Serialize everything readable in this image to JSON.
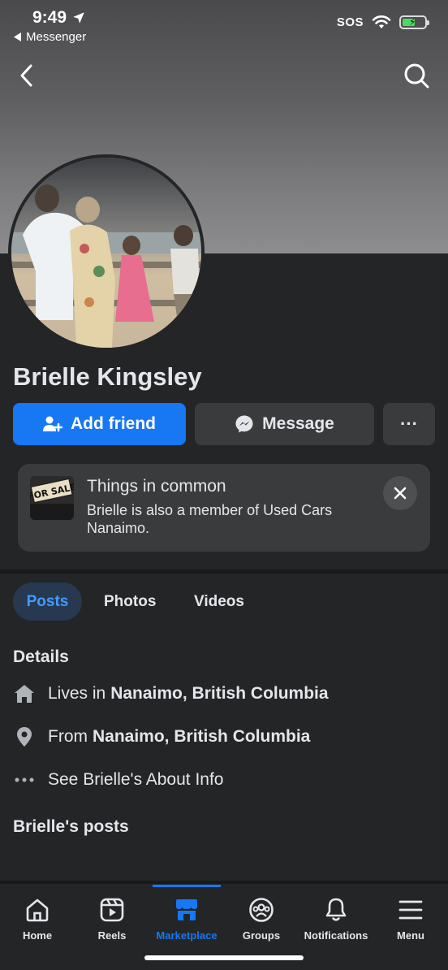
{
  "status_bar": {
    "time": "9:49",
    "back_app": "Messenger",
    "sos": "SOS"
  },
  "profile": {
    "name": "Brielle Kingsley"
  },
  "actions": {
    "add_friend": "Add friend",
    "message": "Message",
    "more": "···"
  },
  "things_in_common": {
    "title": "Things in common",
    "text": "Brielle is also a member of Used Cars Nanaimo.",
    "thumb_text": "FOR SALE"
  },
  "tabs": [
    {
      "label": "Posts",
      "active": true
    },
    {
      "label": "Photos",
      "active": false
    },
    {
      "label": "Videos",
      "active": false
    }
  ],
  "details": {
    "title": "Details",
    "lives_prefix": "Lives in",
    "lives_value": "Nanaimo, British Columbia",
    "from_prefix": "From",
    "from_value": "Nanaimo, British Columbia",
    "about": "See Brielle's About Info"
  },
  "posts_title": "Brielle's posts",
  "bottom_nav": [
    {
      "label": "Home",
      "icon": "home-icon",
      "active": false
    },
    {
      "label": "Reels",
      "icon": "reels-icon",
      "active": false
    },
    {
      "label": "Marketplace",
      "icon": "marketplace-icon",
      "active": true
    },
    {
      "label": "Groups",
      "icon": "groups-icon",
      "active": false
    },
    {
      "label": "Notifications",
      "icon": "bell-icon",
      "active": false
    },
    {
      "label": "Menu",
      "icon": "menu-icon",
      "active": false
    }
  ],
  "colors": {
    "accent": "#1877f2",
    "background": "#242526",
    "card": "#3a3b3c",
    "active_tab_bg": "#263951"
  }
}
